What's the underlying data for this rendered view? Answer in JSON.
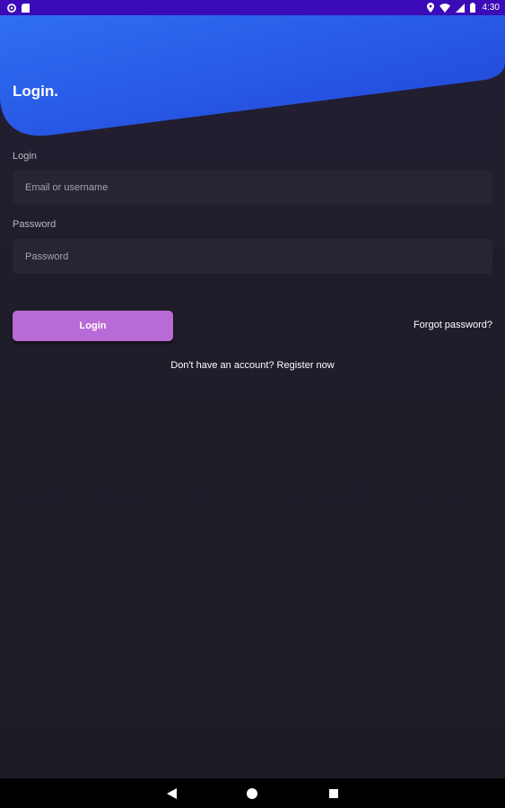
{
  "status_bar": {
    "time": "4:30",
    "left_icons": [
      "settings-icon",
      "sd-card-icon"
    ],
    "right_icons": [
      "location-icon",
      "wifi-icon",
      "signal-icon",
      "battery-icon"
    ],
    "color": "#3a0bb6"
  },
  "header": {
    "title": "Login.",
    "gradient_start": "#2f6ff3",
    "gradient_end": "#2045d8"
  },
  "form": {
    "login_label": "Login",
    "login_placeholder": "Email or username",
    "password_label": "Password",
    "password_placeholder": "Password"
  },
  "actions": {
    "login_button": "Login",
    "forgot_password": "Forgot password?",
    "register_prompt": "Don't have an account? Register now",
    "button_color": "#b86ad6"
  },
  "nav_bar": {
    "buttons": [
      "back-icon",
      "home-icon",
      "recents-icon"
    ]
  }
}
